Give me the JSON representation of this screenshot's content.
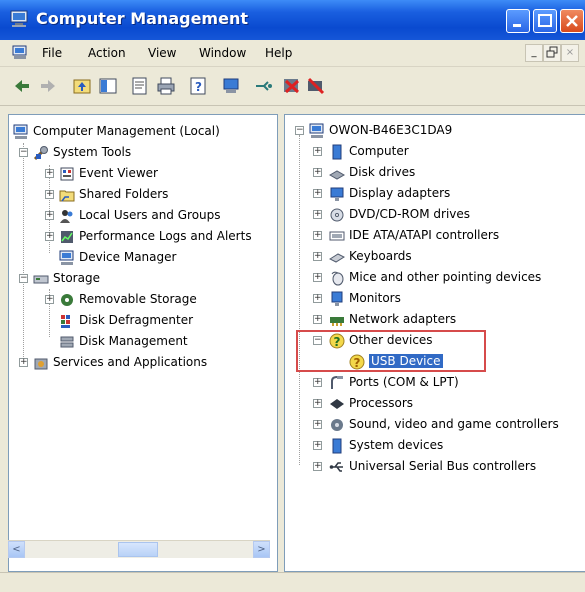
{
  "window": {
    "title": "Computer Management",
    "colors": {
      "titlebar": "#0a4ad0",
      "selection": "#316ac5",
      "highlight_box": "#d64b4b"
    }
  },
  "menu": {
    "items": [
      "File",
      "Action",
      "View",
      "Window",
      "Help"
    ],
    "mdi_buttons": [
      "_",
      "̅",
      "×"
    ]
  },
  "toolbar": {
    "icons": [
      "back-icon",
      "forward-icon",
      "up-folder-icon",
      "show-hide-tree-icon",
      "properties-icon",
      "print-icon",
      "help-icon",
      "scan-hardware-icon",
      "update-driver-icon",
      "disable-icon",
      "uninstall-icon"
    ]
  },
  "left_tree": {
    "root": "Computer Management (Local)",
    "system_tools": "System Tools",
    "event_viewer": "Event Viewer",
    "shared_folders": "Shared Folders",
    "local_users": "Local Users and Groups",
    "perf_logs": "Performance Logs and Alerts",
    "device_manager": "Device Manager",
    "storage": "Storage",
    "removable_storage": "Removable Storage",
    "disk_defrag": "Disk Defragmenter",
    "disk_mgmt": "Disk Management",
    "services": "Services and Applications"
  },
  "right_tree": {
    "root": "OWON-B46E3C1DA9",
    "items": [
      "Computer",
      "Disk drives",
      "Display adapters",
      "DVD/CD-ROM drives",
      "IDE ATA/ATAPI controllers",
      "Keyboards",
      "Mice and other pointing devices",
      "Monitors",
      "Network adapters",
      "Other devices"
    ],
    "usb_device": "USB Device",
    "items_after": [
      "Ports (COM & LPT)",
      "Processors",
      "Sound, video and game controllers",
      "System devices",
      "Universal Serial Bus controllers"
    ]
  },
  "scrollbar": {
    "left_arrow": "<",
    "right_arrow": ">"
  }
}
